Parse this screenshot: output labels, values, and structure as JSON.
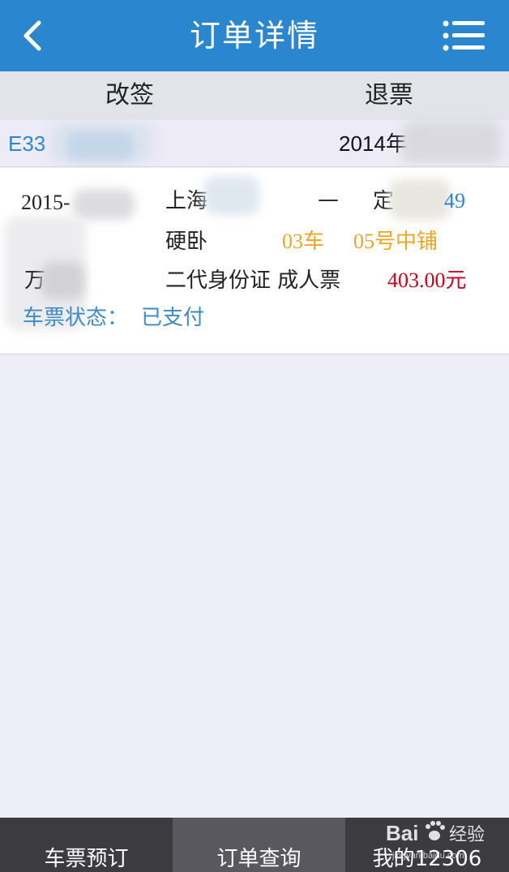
{
  "header": {
    "title": "订单详情",
    "back_icon": "chevron-left-icon",
    "menu_icon": "hamburger-menu-icon",
    "bg_color": "#2a87cf"
  },
  "actions": {
    "change_label": "改签",
    "refund_label": "退票"
  },
  "order": {
    "number": "E33",
    "date": "2014年"
  },
  "ticket": {
    "travel_date": "2015-",
    "from_station": "上海",
    "separator": "—",
    "to_station": "定",
    "seat_number": "49",
    "seat_type": "硬卧",
    "car": "03车",
    "berth": "05号中铺",
    "passenger_name": "万",
    "id_and_ticket_type": "二代身份证 成人票",
    "price": "403.00元",
    "status_label": "车票状态：",
    "status_value": "已支付"
  },
  "tabs": [
    {
      "label": "车票预订"
    },
    {
      "label": "订单查询"
    },
    {
      "label": "我的12306"
    }
  ],
  "watermark": {
    "brand": "Bai",
    "suffix": "经验",
    "url": "jingyan.baidu.com"
  },
  "colors": {
    "accent": "#2a87cf",
    "seat_info": "#f0a61e",
    "price": "#d0021b",
    "status": "#3b8bc6",
    "tabbar": "#3b3b40",
    "tab_active": "#58585e"
  }
}
